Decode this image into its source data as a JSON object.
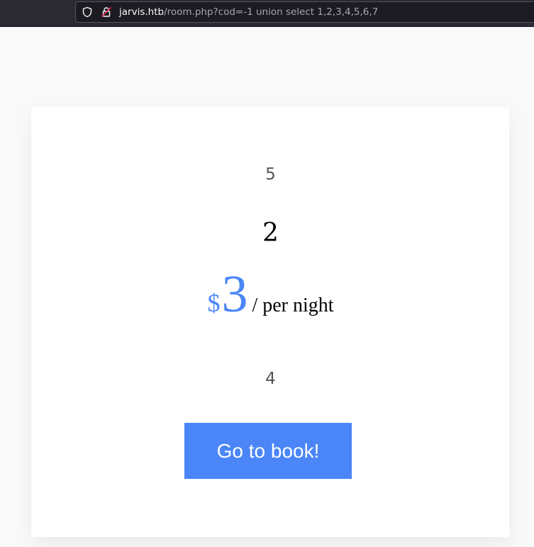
{
  "browser": {
    "url_host": "jarvis.htb",
    "url_path": "/room.php?cod=-1 union select 1,2,3,4,5,6,7",
    "icons": [
      "shield-icon",
      "lock-warning-icon"
    ]
  },
  "room": {
    "field_top": "5",
    "title": "2",
    "currency": "$",
    "price": "3",
    "per_night": "/ per night",
    "field_bottom": "4",
    "book_label": "Go to book!"
  },
  "colors": {
    "accent": "#4a86f7",
    "card": "#ffffff",
    "page_bg": "#f9f9fa",
    "toolbar": "#2b2a33"
  }
}
